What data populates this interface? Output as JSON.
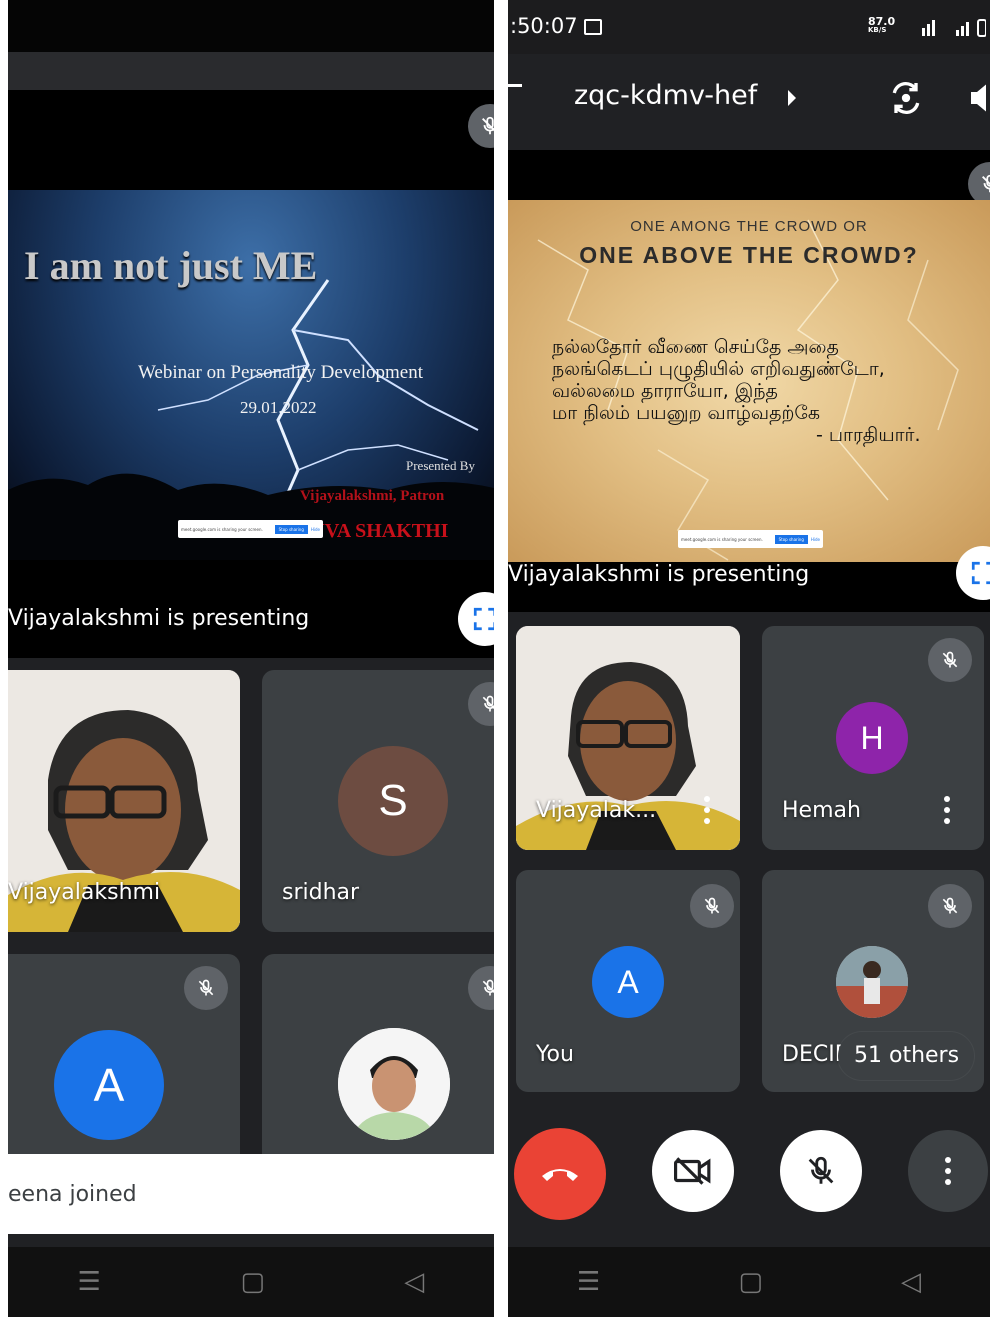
{
  "left": {
    "slide": {
      "title": "I am not just ME",
      "subtitle": "Webinar on Personality Development",
      "date": "29.01.2022",
      "presented_by": "Presented By",
      "presenter": "Vijayalakshmi, Patron",
      "org": "YUVA SHAKTHI",
      "share_bar_text": "meet.google.com is sharing your screen.",
      "share_bar_button": "Stop sharing",
      "share_bar_hide": "Hide"
    },
    "presenting_label": "Vijayalakshmi is presenting",
    "tiles": {
      "vijay_name": "Vijayalakshmi",
      "sridhar_name": "sridhar",
      "sridhar_initial": "S",
      "a_initial": "A"
    },
    "toast": "eena joined"
  },
  "right": {
    "status": {
      "time": ":50:07",
      "speed": "87.0",
      "speed_unit": "KB/S"
    },
    "meeting_code": "zqc-kdmv-hef",
    "slide": {
      "line1": "ONE AMONG THE CROWD OR",
      "line2": "ONE ABOVE THE CROWD?",
      "tamil1": "நல்லதோர் வீணை செய்தே அதை",
      "tamil2": "நலங்கெடப் புழுதியில் எறிவதுண்டோ,",
      "tamil3": "வல்லமை தாராயோ, இந்த",
      "tamil4": "மா நிலம் பயனுற வாழ்வதற்கே",
      "tamil5": "- பாரதியார்.",
      "share_bar_text": "meet.google.com is sharing your screen.",
      "share_bar_button": "Stop sharing",
      "share_bar_hide": "Hide"
    },
    "presenting_label": "Vijayalakshmi is presenting",
    "tiles": {
      "vijay_name": "Vijayalak...",
      "hemah_name": "Hemah",
      "hemah_initial": "H",
      "you_name": "You",
      "you_initial": "A",
      "dec_name": "DECID",
      "others": "51 others"
    }
  },
  "colors": {
    "meet_bg": "#202124",
    "tile_bg": "#3c4043",
    "end_call": "#ea4335",
    "avatar_blue": "#1a73e8",
    "avatar_purple": "#8e24aa",
    "avatar_brown": "#6d4c41"
  },
  "icons": [
    "mic-off-icon",
    "expand-icon",
    "rotate-camera-icon",
    "speaker-icon",
    "end-call-icon",
    "camera-off-icon",
    "more-icon",
    "back-icon",
    "home-icon",
    "menu-icon"
  ]
}
